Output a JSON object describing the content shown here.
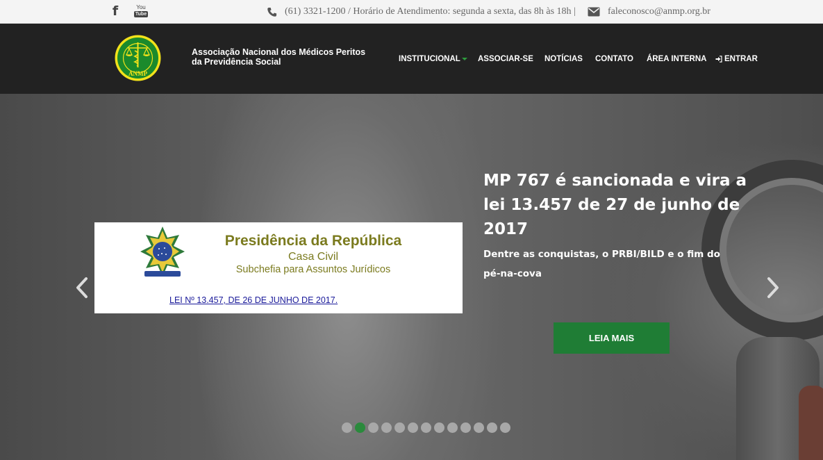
{
  "topbar": {
    "social": [
      "facebook-icon",
      "youtube-icon"
    ],
    "youtube_top": "You",
    "youtube_bottom": "Tube",
    "phone": "(61) 3321-1200 / Horário de Atendimento: segunda a sexta, das 8h às 18h |",
    "email": "faleconosco@anmp.org.br"
  },
  "header": {
    "logo_text": "ANMP",
    "brand_line1": "Associação Nacional dos Médicos Peritos",
    "brand_line2": "da Previdência Social",
    "nav": {
      "institucional": "INSTITUCIONAL",
      "associar": "ASSOCIAR-SE",
      "noticias": "NOTÍCIAS",
      "contato": "CONTATO",
      "area_interna": "ÁREA INTERNA",
      "entrar": "ENTRAR"
    },
    "accent_color": "#2e9c3e"
  },
  "slider": {
    "image": {
      "title": "Presidência da República",
      "subtitle1": "Casa Civil",
      "subtitle2": "Subchefia para Assuntos Jurídicos",
      "link": "LEI Nº 13.457, DE 26 DE JUNHO DE 2017."
    },
    "title": "MP 767 é sancionada e vira a lei 13.457 de 27 de junho de 2017",
    "description": "Dentre as conquistas, o PRBI/BILD e o fim do pé-na-cova",
    "button": "LEIA MAIS",
    "button_color": "#1f7d35",
    "dots_total": 13,
    "active_dot": 2
  }
}
